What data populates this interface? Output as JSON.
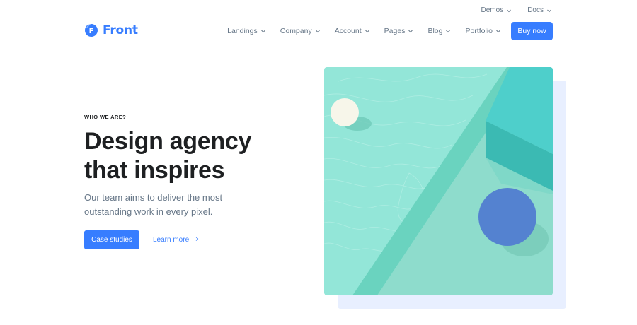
{
  "topbar": {
    "items": [
      {
        "label": "Demos"
      },
      {
        "label": "Docs"
      }
    ]
  },
  "brand": {
    "mark_letter": "F",
    "name": "Front"
  },
  "nav": {
    "items": [
      {
        "label": "Landings"
      },
      {
        "label": "Company"
      },
      {
        "label": "Account"
      },
      {
        "label": "Pages"
      },
      {
        "label": "Blog"
      },
      {
        "label": "Portfolio"
      }
    ],
    "cta_label": "Buy now"
  },
  "hero": {
    "eyebrow": "WHO WE ARE?",
    "headline_line1": "Design agency",
    "headline_line2": "that inspires",
    "lead": "Our team aims to deliver the most outstanding work in every pixel.",
    "primary_button": "Case studies",
    "link_label": "Learn more"
  },
  "colors": {
    "primary": "#377dff",
    "text_dark": "#1e2022",
    "text_muted": "#677788",
    "hero_back": "#e8efff"
  },
  "icons": {
    "dropdown": "chevron-down-icon",
    "link": "chevron-right-icon"
  }
}
